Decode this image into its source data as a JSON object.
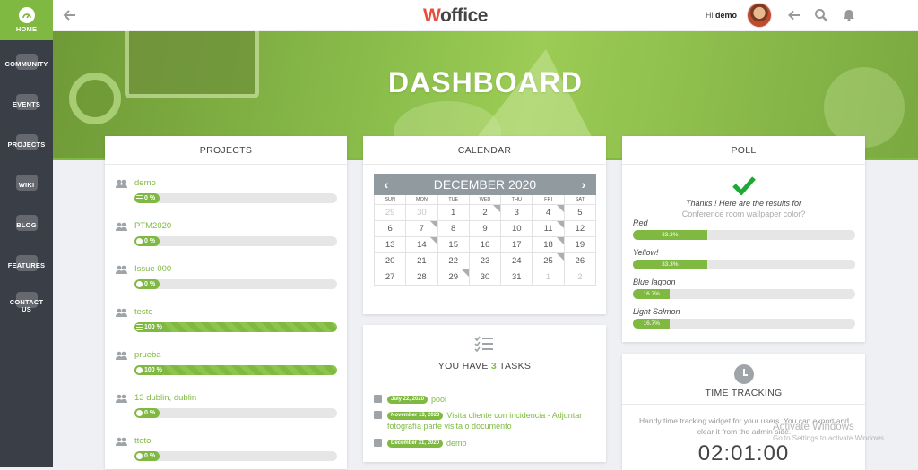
{
  "sidebar": {
    "items": [
      {
        "label": "HOME",
        "active": true
      },
      {
        "label": "COMMUNITY"
      },
      {
        "label": "EVENTS"
      },
      {
        "label": "PROJECTS"
      },
      {
        "label": "WIKI"
      },
      {
        "label": "BLOG"
      },
      {
        "label": "FEATURES"
      },
      {
        "label": "CONTACT US"
      }
    ]
  },
  "header": {
    "logo_first": "W",
    "logo_rest": "office",
    "greeting_hi": "Hi",
    "greeting_user": "demo"
  },
  "hero": {
    "title": "DASHBOARD"
  },
  "projects": {
    "title": "PROJECTS",
    "items": [
      {
        "name": "demo",
        "progress": 0,
        "label": "0 %"
      },
      {
        "name": "PTM2020",
        "progress": 0,
        "label": "0 %"
      },
      {
        "name": "Issue 000",
        "progress": 0,
        "label": "0 %"
      },
      {
        "name": "teste",
        "progress": 100,
        "label": "100 %"
      },
      {
        "name": "prueba",
        "progress": 100,
        "label": "100 %"
      },
      {
        "name": "13 dublin, dublin",
        "progress": 0,
        "label": "0 %"
      },
      {
        "name": "ttoto",
        "progress": 0,
        "label": "0 %"
      }
    ]
  },
  "calendar": {
    "title": "CALENDAR",
    "month": "DECEMBER 2020",
    "prev": "‹",
    "next": "›",
    "dow": [
      "SUN",
      "MON",
      "TUE",
      "WED",
      "THU",
      "FRI",
      "SAT"
    ],
    "weeks": [
      [
        "29",
        "30",
        "1",
        "2",
        "3",
        "4",
        "5"
      ],
      [
        "6",
        "7",
        "8",
        "9",
        "10",
        "11",
        "12"
      ],
      [
        "13",
        "14",
        "15",
        "16",
        "17",
        "18",
        "19"
      ],
      [
        "20",
        "21",
        "22",
        "23",
        "24",
        "25",
        "26"
      ],
      [
        "27",
        "28",
        "29",
        "30",
        "31",
        "1",
        "2"
      ]
    ]
  },
  "tasks": {
    "prefix": "YOU HAVE ",
    "count": "3",
    "suffix": " TASKS",
    "items": [
      {
        "date": "July 22, 2020",
        "text": "pool"
      },
      {
        "date": "November 13, 2020",
        "text": "Visita cliente con incidencia - Adjuntar fotografía parte visita o documento"
      },
      {
        "date": "December 31, 2020",
        "text": "demo"
      }
    ]
  },
  "poll": {
    "title": "POLL",
    "message": "Thanks ! Here are the results for",
    "question": "Conference room wallpaper color?",
    "options": [
      {
        "label": "Red",
        "percent": 33.3,
        "text": "33.3%"
      },
      {
        "label": "Yellow!",
        "percent": 33.3,
        "text": "33.3%"
      },
      {
        "label": "Blue lagoon",
        "percent": 16.7,
        "text": "16.7%"
      },
      {
        "label": "Light Salmon",
        "percent": 16.7,
        "text": "16.7%"
      }
    ]
  },
  "time_tracking": {
    "title": "TIME TRACKING",
    "description": "Handy time tracking widget for your users. You can export and clear it from the admin side.",
    "time": "02:01:00"
  },
  "watermark": {
    "title": "Activate Windows",
    "subtitle": "Go to Settings to activate Windows."
  },
  "colors": {
    "accent": "#7fb942",
    "sidebar": "#3a3e47",
    "logo_w": "#e94e3c"
  }
}
